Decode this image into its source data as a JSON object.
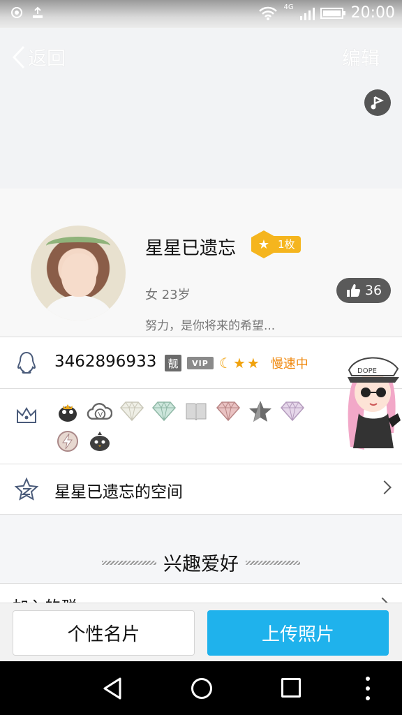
{
  "status_bar": {
    "network": "4G",
    "time": "20:00"
  },
  "header": {
    "back_label": "返回",
    "edit_label": "编辑"
  },
  "profile": {
    "nickname": "星星已遗忘",
    "medal_count": "1枚",
    "gender_age": "女 23岁",
    "motto": "努力，是你将来的希望...",
    "likes": "36"
  },
  "account": {
    "qq_number": "3462896933",
    "liang_badge": "靓",
    "vip_badge": "VIP",
    "speed_status": "慢速中"
  },
  "badges": [
    "penguin-crown-badge",
    "cloud-v-badge",
    "white-diamond-badge",
    "green-diamond-badge",
    "book-badge",
    "red-diamond-badge",
    "star-badge",
    "purple-diamond-badge",
    "lightning-badge",
    "bird-badge"
  ],
  "space": {
    "label": "星星已遗忘的空间"
  },
  "interests": {
    "title": "兴趣爱好"
  },
  "joined_groups": {
    "label": "加入的群"
  },
  "actions": {
    "card_label": "个性名片",
    "upload_label": "上传照片"
  },
  "colors": {
    "primary": "#1fb2ec",
    "gold": "#f5b51e",
    "orange": "#f08a10"
  }
}
